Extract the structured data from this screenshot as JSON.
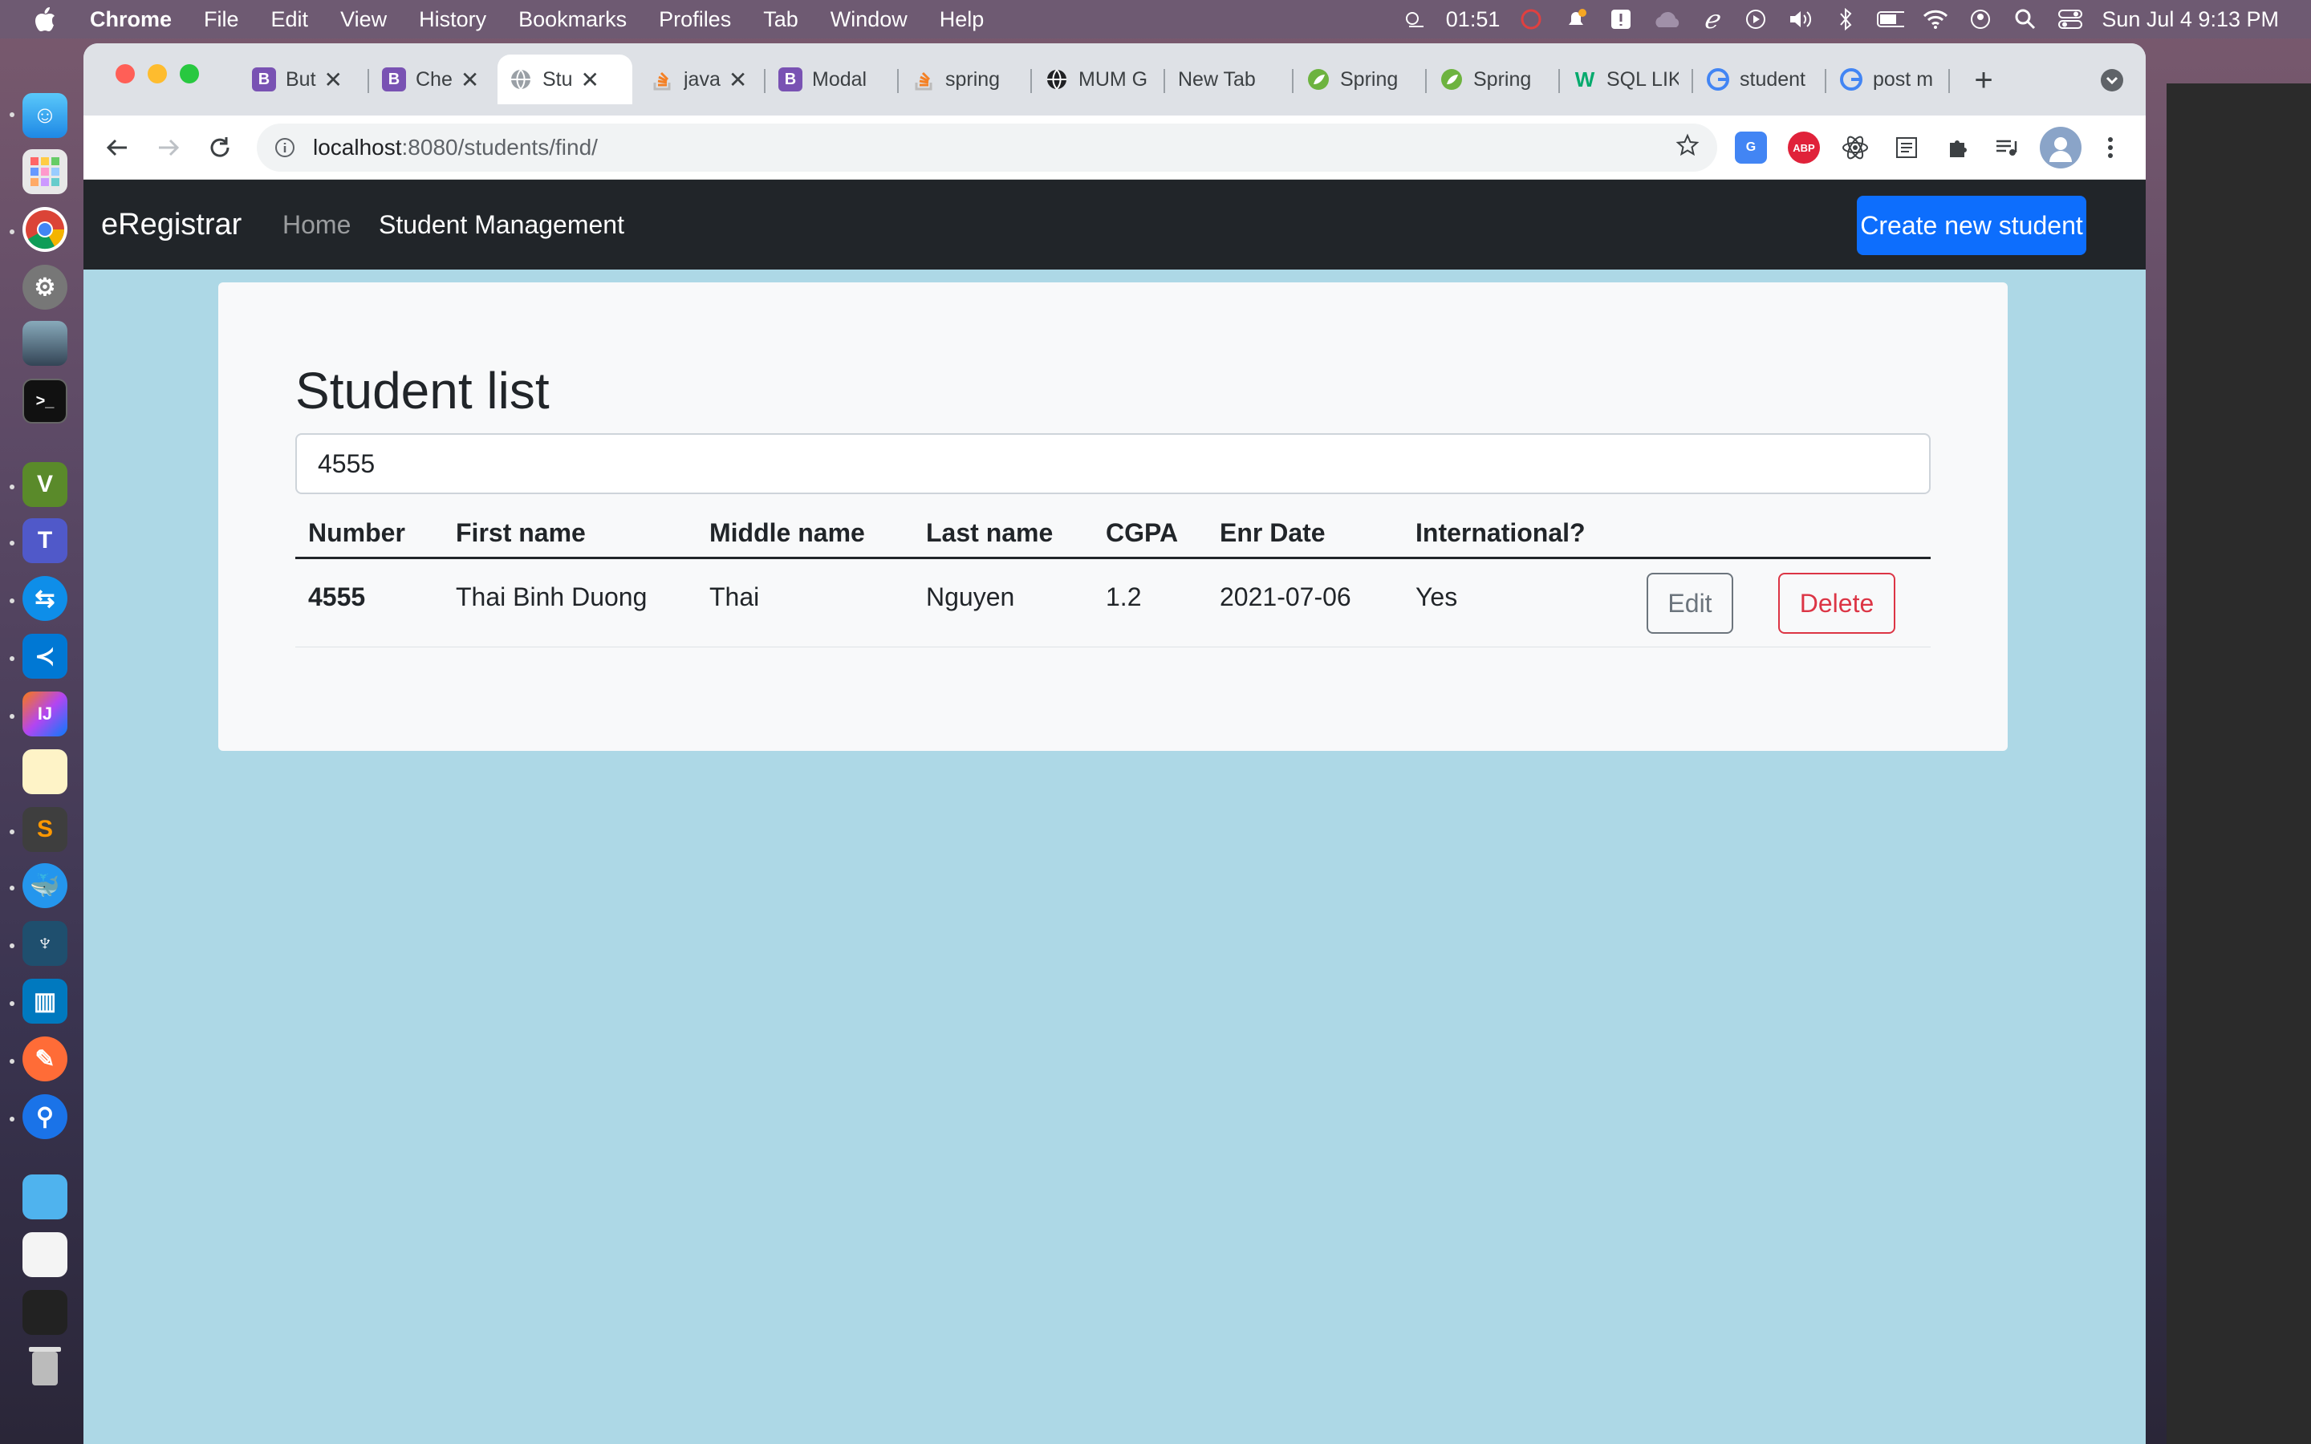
{
  "menubar": {
    "app": "Chrome",
    "items": [
      "File",
      "Edit",
      "View",
      "History",
      "Bookmarks",
      "Profiles",
      "Tab",
      "Window",
      "Help"
    ],
    "timer": "01:51",
    "datetime": "Sun Jul 4  9:13 PM"
  },
  "tabs": [
    {
      "label": "But",
      "favicon": "bootstrap-icon",
      "color": "#7952b3"
    },
    {
      "label": "Che",
      "favicon": "bootstrap-icon",
      "color": "#7952b3"
    },
    {
      "label": "Stu",
      "favicon": "globe-icon",
      "color": "#9aa0a6",
      "active": true
    },
    {
      "label": "java",
      "favicon": "stackoverflow-icon",
      "color": "#f48024"
    },
    {
      "label": "Modal",
      "favicon": "bootstrap-icon",
      "color": "#7952b3"
    },
    {
      "label": "spring",
      "favicon": "stackoverflow-icon",
      "color": "#f48024"
    },
    {
      "label": "MUM G",
      "favicon": "globe-icon",
      "color": "#202124"
    },
    {
      "label": "New Tab",
      "favicon": "",
      "color": ""
    },
    {
      "label": "Spring",
      "favicon": "spring-icon",
      "color": "#6db33f"
    },
    {
      "label": "Spring",
      "favicon": "spring-icon",
      "color": "#6db33f"
    },
    {
      "label": "SQL LIK",
      "favicon": "w3schools-icon",
      "color": "#04aa6d"
    },
    {
      "label": "student",
      "favicon": "google-icon",
      "color": "#4285f4"
    },
    {
      "label": "post m",
      "favicon": "google-icon",
      "color": "#4285f4"
    }
  ],
  "address": {
    "host": "localhost",
    "path": ":8080/students/find/"
  },
  "navbar": {
    "brand": "eRegistrar",
    "home": "Home",
    "student_management": "Student Management",
    "create_button": "Create new student"
  },
  "content": {
    "title": "Student list",
    "search_value": "4555",
    "columns": [
      "Number",
      "First name",
      "Middle name",
      "Last name",
      "CGPA",
      "Enr Date",
      "International?"
    ],
    "rows": [
      {
        "number": "4555",
        "first": "Thai Binh Duong",
        "middle": "Thai",
        "last": "Nguyen",
        "cgpa": "1.2",
        "date": "2021-07-06",
        "intl": "Yes"
      }
    ],
    "edit_label": "Edit",
    "delete_label": "Delete"
  },
  "colors": {
    "accent": "#0d6efd",
    "danger": "#dc3545",
    "page_bg": "#add8e6",
    "navbar_bg": "#212529"
  }
}
